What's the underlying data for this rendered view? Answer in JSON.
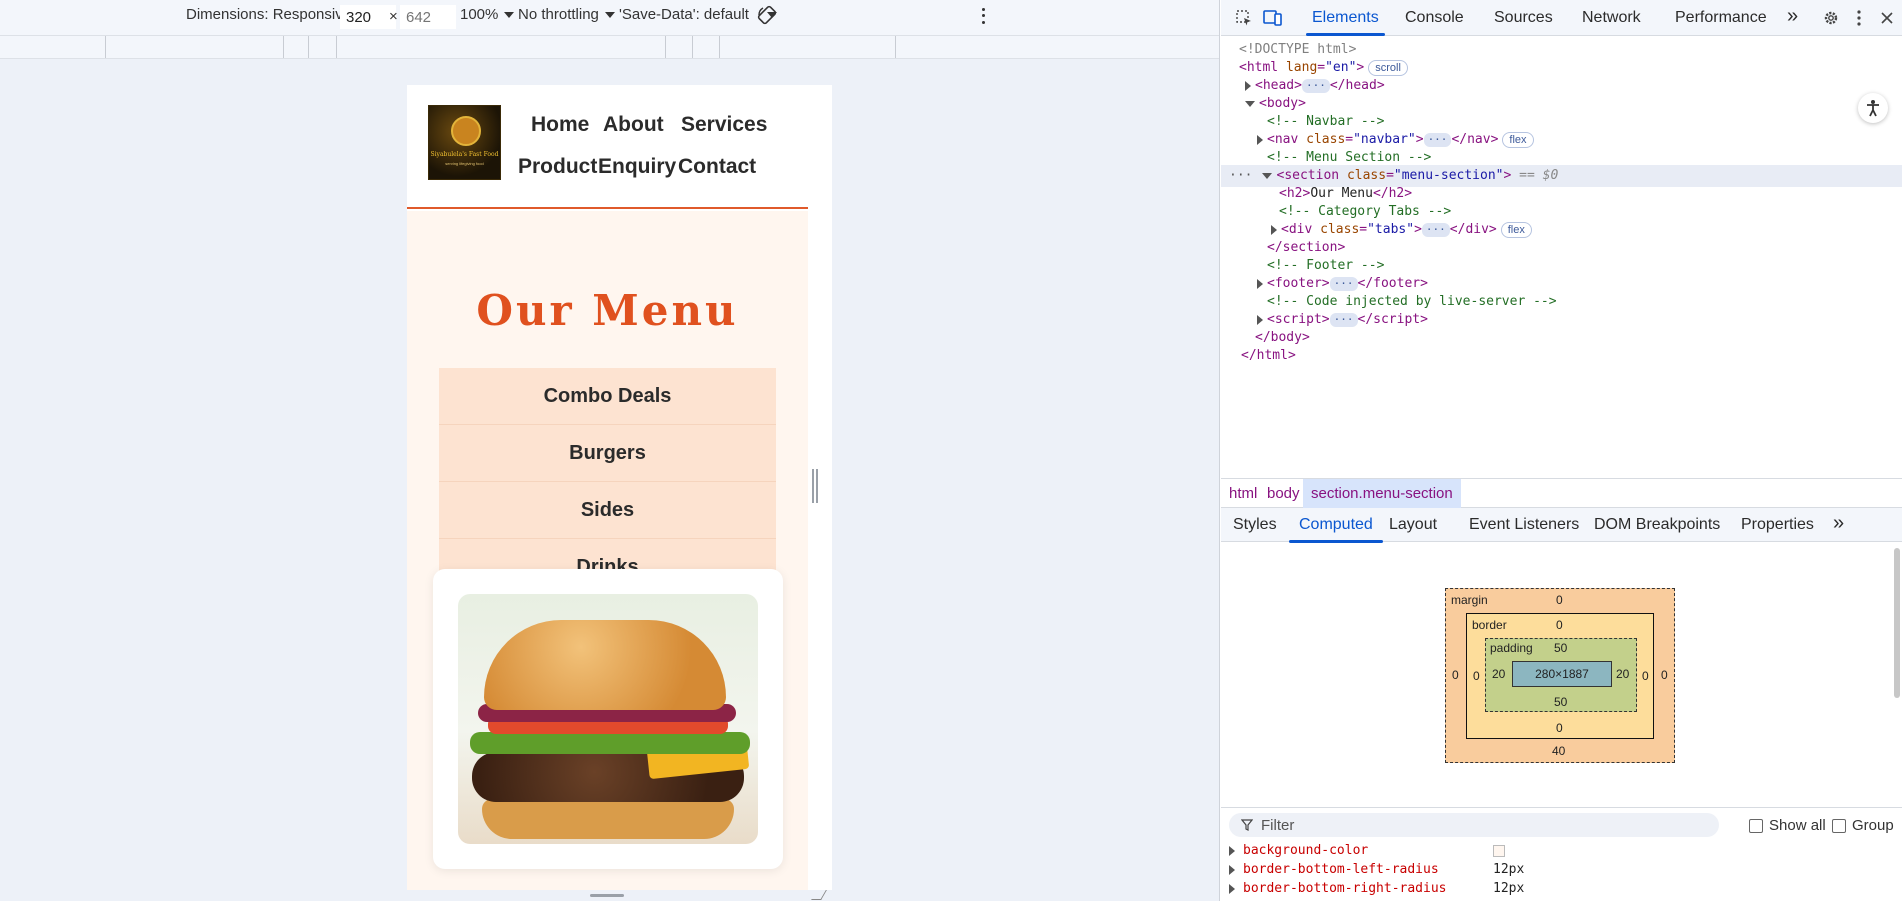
{
  "devtools_toolbar": {
    "dimensions_label": "Dimensions: Responsive",
    "width_value": "320",
    "times": "×",
    "height_placeholder": "642",
    "zoom": "100%",
    "throttling": "No throttling",
    "save_data": "'Save-Data': default"
  },
  "site": {
    "logo_text_1": "Siyabulela's Fast Food",
    "logo_text_2": "serving lifegiving food",
    "nav": [
      "Home",
      "About",
      "Services",
      "Product",
      "Enquiry",
      "Contact"
    ],
    "menu_title": "Our Menu",
    "tabs": [
      "Combo Deals",
      "Burgers",
      "Sides",
      "Drinks"
    ]
  },
  "devtools": {
    "main_tabs": [
      "Elements",
      "Console",
      "Sources",
      "Network",
      "Performance"
    ],
    "more_tabs": "»",
    "dom": {
      "doctype": "<!DOCTYPE html>",
      "html_open_tag": "html",
      "html_lang_attr": "lang",
      "html_lang_val": "\"en\"",
      "scroll_badge": "scroll",
      "head_tag": "head",
      "body_tag": "body",
      "comment_navbar": "<!-- Navbar -->",
      "nav_tag": "nav",
      "class_attr": "class",
      "nav_class_val": "\"navbar\"",
      "flex_badge": "flex",
      "comment_menu": "<!-- Menu Section -->",
      "section_tag": "section",
      "section_class_val": "\"menu-section\"",
      "eq_dollar0": "== $0",
      "h2_text": "Our Menu",
      "comment_tabs": "<!-- Category Tabs -->",
      "div_tag": "div",
      "div_class_val": "\"tabs\"",
      "section_close": "</section>",
      "comment_footer": "<!-- Footer -->",
      "footer_tag": "footer",
      "comment_live": "<!-- Code injected by live-server -->",
      "script_tag": "script",
      "body_close": "</body>",
      "html_close": "</html>",
      "ellipsis": "···",
      "row_dots": "···"
    },
    "breadcrumbs": [
      "html",
      "body",
      "section.menu-section"
    ],
    "sub_tabs": [
      "Styles",
      "Computed",
      "Layout",
      "Event Listeners",
      "DOM Breakpoints",
      "Properties"
    ],
    "box_model": {
      "margin_label": "margin",
      "margin_top": "0",
      "margin_bottom": "40",
      "margin_left": "0",
      "margin_right": "0",
      "border_label": "border",
      "border_top": "0",
      "border_bottom": "0",
      "border_left": "0",
      "border_right": "0",
      "padding_label": "padding",
      "padding_top": "50",
      "padding_bottom": "50",
      "padding_left": "20",
      "padding_right": "20",
      "content": "280×1887"
    },
    "filter_placeholder": "Filter",
    "show_all": "Show all",
    "group": "Group",
    "computed_props": [
      {
        "name": "background-color",
        "value": ""
      },
      {
        "name": "border-bottom-left-radius",
        "value": "12px"
      },
      {
        "name": "border-bottom-right-radius",
        "value": "12px"
      }
    ]
  },
  "colors": {
    "accent": "#e0511f",
    "tab_bg": "#fde3d1",
    "section_bg": "#fff6ef",
    "devtools_blue": "#0b57d0"
  }
}
